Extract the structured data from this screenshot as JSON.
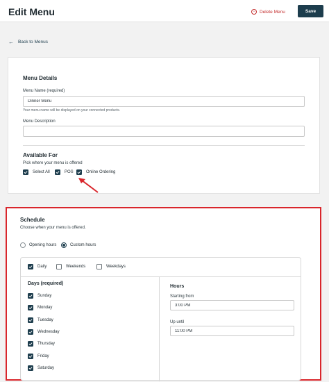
{
  "header": {
    "title": "Edit Menu",
    "delete_label": "Delete Menu",
    "save_label": "Save"
  },
  "back_link": "Back to Menus",
  "menu_details": {
    "heading": "Menu Details",
    "name_label": "Menu Name (required)",
    "name_value": "Dinner Menu",
    "name_help": "Your menu name will be displayed on your connected products.",
    "description_label": "Menu Description",
    "description_value": ""
  },
  "available_for": {
    "heading": "Available For",
    "subtitle": "Pick where your menu is offered",
    "options": [
      {
        "label": "Select All",
        "checked": true
      },
      {
        "label": "POS",
        "checked": true
      },
      {
        "label": "Online Ordering",
        "checked": true
      }
    ]
  },
  "schedule": {
    "heading": "Schedule",
    "subtitle": "Choose when your menu is offered.",
    "radios": [
      {
        "label": "Opening hours",
        "selected": false
      },
      {
        "label": "Custom hours",
        "selected": true
      }
    ],
    "presets": [
      {
        "label": "Daily",
        "checked": true
      },
      {
        "label": "Weekends",
        "checked": false
      },
      {
        "label": "Weekdays",
        "checked": false
      }
    ],
    "days_heading": "Days (required)",
    "days": [
      {
        "label": "Sunday",
        "checked": true
      },
      {
        "label": "Monday",
        "checked": true
      },
      {
        "label": "Tuesday",
        "checked": true
      },
      {
        "label": "Wednesday",
        "checked": true
      },
      {
        "label": "Thursday",
        "checked": true
      },
      {
        "label": "Friday",
        "checked": true
      },
      {
        "label": "Saturday",
        "checked": true
      }
    ],
    "hours_heading": "Hours",
    "starting_label": "Starting from",
    "starting_value": "3:00 PM",
    "until_label": "Up until",
    "until_value": "11:00 PM"
  },
  "colors": {
    "primary": "#1d3d4d",
    "danger": "#c42f2f",
    "highlight_frame": "#d9262c"
  },
  "icons": [
    "delete-icon",
    "back-arrow-icon",
    "checkmark-icon",
    "annotation-arrow-icon"
  ]
}
